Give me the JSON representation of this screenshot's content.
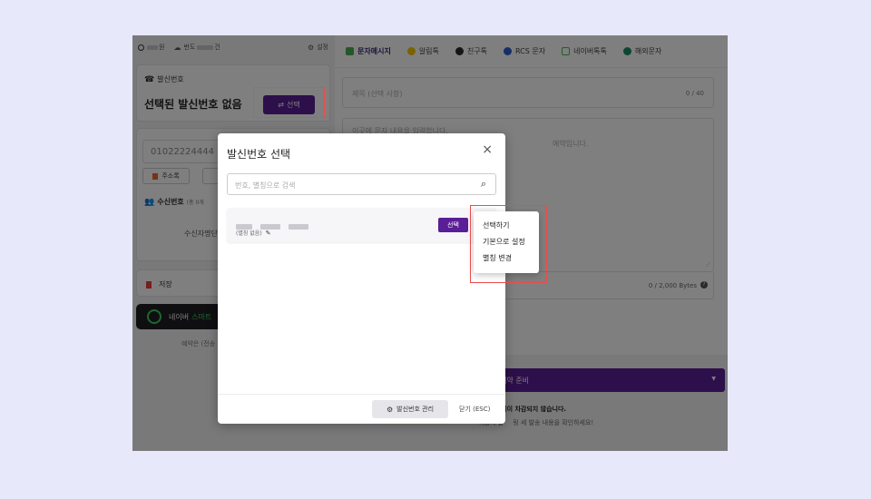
{
  "left": {
    "top_bar": {
      "points_label": "원",
      "coupon_label": "번도",
      "coupon_suffix": "건",
      "settings_label": "설정"
    },
    "sender": {
      "section_label": "발신번호",
      "none_selected": "선택된 발신번호 없음",
      "select_button": "선택"
    },
    "recipient": {
      "phone_value": "01022224444",
      "addressbook_button": "주소록",
      "count_label": "수신번호",
      "count_note": "(총 0개",
      "recipient_name_label": "수신자명단"
    },
    "save_label": "저장",
    "naver_banner": {
      "brand": "네이버",
      "highlight": "스마트"
    },
    "reserve_note": "예약은 (전송"
  },
  "right": {
    "tabs": [
      {
        "label": "문자메시지",
        "color": "#4caf50",
        "active": true
      },
      {
        "label": "알림톡",
        "color": "#f5c400",
        "active": false
      },
      {
        "label": "친구톡",
        "color": "#2b2b2b",
        "active": false
      },
      {
        "label": "RCS 문자",
        "color": "#2f5fd0",
        "active": false
      },
      {
        "label": "네이버톡톡",
        "color": "#35c24d",
        "active": false
      },
      {
        "label": "해외문자",
        "color": "#1a8a6a",
        "active": false
      }
    ],
    "subject_placeholder": "제목 (선택 사항)",
    "subject_counter": "0 / 40",
    "body_placeholder": "이곳에 문자 내용을 입력합니다.",
    "body_placeholder_tail": "예약입니다.",
    "byte_counter": "0 / 2,000 Bytes",
    "send_bar_label": "송/예약 준비",
    "notice_bold": "잔액이 차감되지 않습니다.",
    "notice_bold_prefix": "는",
    "notice_line2": "발송 내용을 확인하세요!",
    "notice_line2_prefix": "이동시 필",
    "notice_line2_mid": "링 세"
  },
  "modal": {
    "title": "발신번호 선택",
    "search_placeholder": "번호, 별칭으로 검색",
    "item": {
      "alias": "(별칭 없음)",
      "select_button": "선택"
    },
    "manage_button": "발신번호 관리",
    "close_button": "닫기 (ESC)"
  },
  "context_menu": {
    "items": [
      "선택하기",
      "기본으로 설정",
      "별칭 변경"
    ]
  },
  "colors": {
    "accent": "#5a1e96",
    "highlight_box": "#ec4a4a",
    "page_bg": "#e8e8fb"
  }
}
